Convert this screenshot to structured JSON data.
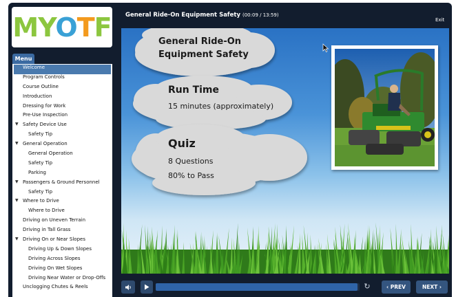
{
  "logo": {
    "text_m": "M",
    "text_y": "Y",
    "text_o": "O",
    "text_t": "T",
    "text_f": "F"
  },
  "header": {
    "title": "General Ride-On Equipment Safety",
    "time": "(00:09 / 13:59)",
    "exit_label": "Exit"
  },
  "menu": {
    "tab_label": "Menu",
    "items": [
      {
        "label": "Welcome",
        "level": 0,
        "selected": true
      },
      {
        "label": "Program Controls",
        "level": 0
      },
      {
        "label": "Course Outline",
        "level": 0
      },
      {
        "label": "Introduction",
        "level": 0
      },
      {
        "label": "Dressing for Work",
        "level": 0
      },
      {
        "label": "Pre-Use Inspection",
        "level": 0
      },
      {
        "label": "Safety Device Use",
        "level": 0,
        "expanded": true
      },
      {
        "label": "Safety Tip",
        "level": 1
      },
      {
        "label": "General Operation",
        "level": 0,
        "expanded": true
      },
      {
        "label": "General Operation",
        "level": 1
      },
      {
        "label": "Safety Tip",
        "level": 1
      },
      {
        "label": "Parking",
        "level": 1
      },
      {
        "label": "Passengers & Ground Personnel",
        "level": 0,
        "expanded": true
      },
      {
        "label": "Safety Tip",
        "level": 1
      },
      {
        "label": "Where to Drive",
        "level": 0,
        "expanded": true
      },
      {
        "label": "Where to Drive",
        "level": 1
      },
      {
        "label": "Driving on Uneven Terrain",
        "level": 0
      },
      {
        "label": "Driving in Tall Grass",
        "level": 0
      },
      {
        "label": "Driving On or Near Slopes",
        "level": 0,
        "expanded": true
      },
      {
        "label": "Driving Up & Down Slopes",
        "level": 1
      },
      {
        "label": "Driving Across Slopes",
        "level": 1
      },
      {
        "label": "Driving On Wet Slopes",
        "level": 1
      },
      {
        "label": "Driving Near Water or Drop-Offs",
        "level": 1
      },
      {
        "label": "Unclogging Chutes & Reels",
        "level": 0
      }
    ]
  },
  "slide": {
    "title_line1": "General Ride-On",
    "title_line2": "Equipment Safety",
    "runtime_heading": "Run Time",
    "runtime_value": "15 minutes (approximately)",
    "quiz_heading": "Quiz",
    "quiz_questions": "8 Questions",
    "quiz_pass": "80% to Pass"
  },
  "controls": {
    "volume_icon": "speaker-icon",
    "play_icon": "play-icon",
    "progress": 0.99,
    "prev_label": "‹ PREV",
    "next_label": "NEXT ›"
  },
  "colors": {
    "accent": "#3b6aa1",
    "frame": "#121d2e",
    "logo_green": "#8cc63f",
    "logo_blue": "#3aa1d6",
    "logo_orange": "#f39a1e"
  }
}
